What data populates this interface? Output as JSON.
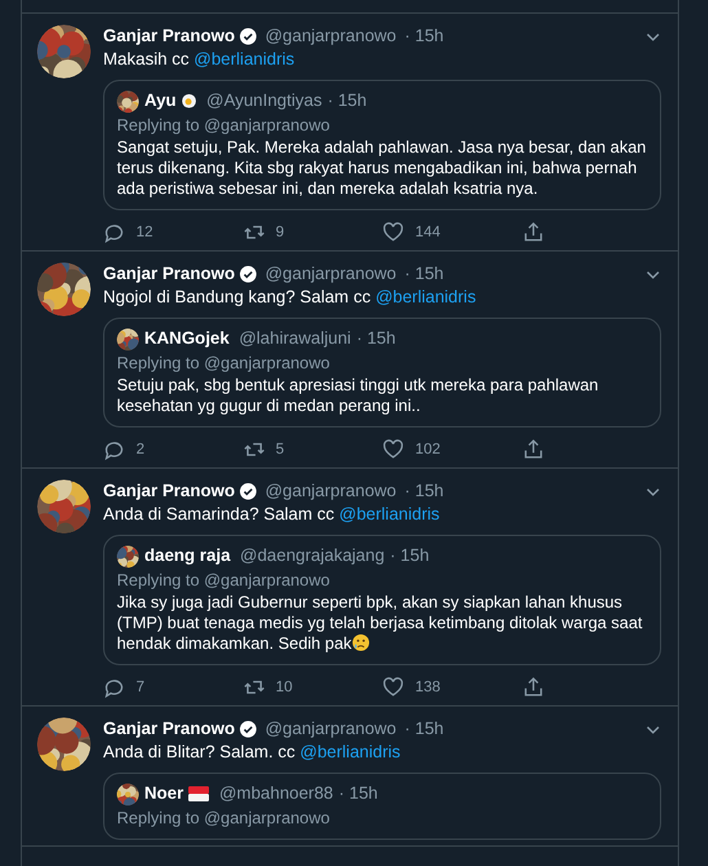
{
  "tweets": [
    {
      "name": "Ganjar Pranowo",
      "verified": true,
      "handle": "@ganjarpranowo",
      "time": "· 15h",
      "text": "Makasih cc",
      "mention": "@berlianidris",
      "quote": {
        "name": "Ayu",
        "egg_icon": true,
        "handle": "@AyunIngtiyas",
        "time": "· 15h",
        "replying": "Replying to @ganjarpranowo",
        "text": "Sangat setuju, Pak. Mereka adalah pahlawan. Jasa nya besar, dan akan terus dikenang. Kita sbg rakyat harus mengabadikan ini, bahwa pernah ada peristiwa sebesar ini, dan mereka adalah ksatria nya."
      },
      "replies": "12",
      "retweets": "9",
      "likes": "144"
    },
    {
      "name": "Ganjar Pranowo",
      "verified": true,
      "handle": "@ganjarpranowo",
      "time": "· 15h",
      "text": "Ngojol di Bandung kang? Salam cc",
      "mention": "@berlianidris",
      "quote": {
        "name": "KANGojek",
        "handle": "@lahirawaljuni",
        "time": "· 15h",
        "replying": "Replying to @ganjarpranowo",
        "text": "Setuju pak, sbg bentuk apresiasi tinggi utk mereka para pahlawan kesehatan yg gugur di medan perang ini.."
      },
      "replies": "2",
      "retweets": "5",
      "likes": "102"
    },
    {
      "name": "Ganjar Pranowo",
      "verified": true,
      "handle": "@ganjarpranowo",
      "time": "· 15h",
      "text": "Anda di Samarinda? Salam cc",
      "mention": "@berlianidris",
      "quote": {
        "name": "daeng raja",
        "handle": "@daengrajakajang",
        "time": "· 15h",
        "replying": "Replying to @ganjarpranowo",
        "text": "Jika sy juga jadi Gubernur seperti bpk, akan sy siapkan lahan khusus (TMP) buat tenaga medis yg telah berjasa ketimbang ditolak warga saat hendak dimakamkan. Sedih pak",
        "crying_icon": true
      },
      "replies": "7",
      "retweets": "10",
      "likes": "138"
    },
    {
      "name": "Ganjar Pranowo",
      "verified": true,
      "handle": "@ganjarpranowo",
      "time": "· 15h",
      "text": "Anda di Blitar? Salam. cc",
      "mention": "@berlianidris",
      "quote": {
        "name": "Noer",
        "flag_icon": true,
        "handle": "@mbahnoer88",
        "time": "· 15h",
        "replying": "Replying to @ganjarpranowo"
      }
    }
  ]
}
